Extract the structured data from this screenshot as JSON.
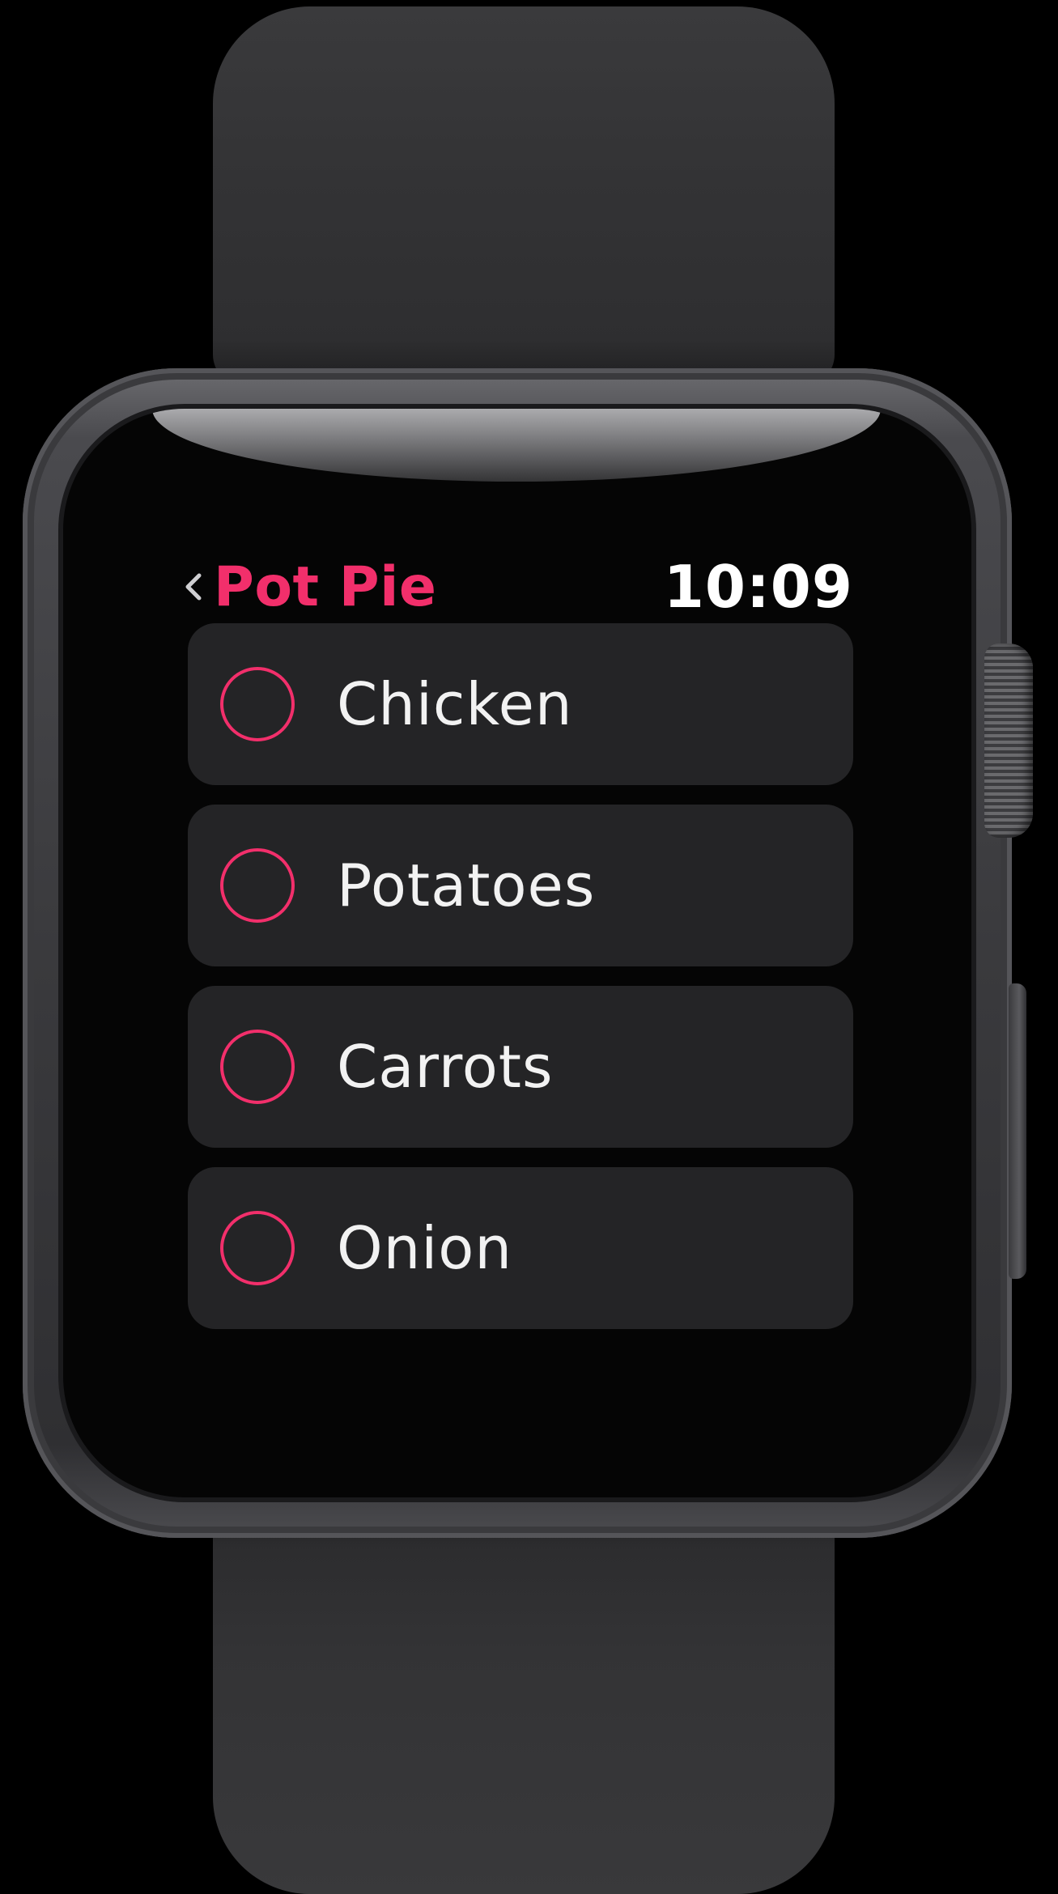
{
  "nav": {
    "back_title": "Pot Pie",
    "time": "10:09"
  },
  "items": [
    {
      "label": "Chicken"
    },
    {
      "label": "Potatoes"
    },
    {
      "label": "Carrots"
    },
    {
      "label": "Onion"
    }
  ],
  "colors": {
    "accent": "#f22f6b",
    "row_background": "#242426",
    "text": "#f2f2f2"
  },
  "icons": {
    "back": "chevron-left-icon",
    "unchecked": "circle-outline-icon"
  }
}
